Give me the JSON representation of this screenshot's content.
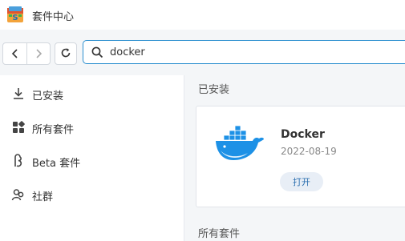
{
  "window": {
    "title": "套件中心"
  },
  "toolbar": {
    "back_icon": "chevron-left-icon",
    "forward_icon": "chevron-right-icon",
    "refresh_icon": "refresh-icon"
  },
  "search": {
    "value": "docker",
    "icon": "search-icon"
  },
  "sidebar": {
    "items": [
      {
        "label": "已安装",
        "icon": "download-icon"
      },
      {
        "label": "所有套件",
        "icon": "grid-icon"
      },
      {
        "label": "Beta 套件",
        "icon": "beta-icon"
      },
      {
        "label": "社群",
        "icon": "community-icon"
      }
    ]
  },
  "main": {
    "installed_title": "已安装",
    "all_title": "所有套件",
    "package": {
      "name": "Docker",
      "date": "2022-08-19",
      "action_label": "打开",
      "icon": "docker-whale-icon"
    }
  },
  "colors": {
    "accent": "#2b8fcf",
    "docker_blue": "#1d91e6"
  }
}
